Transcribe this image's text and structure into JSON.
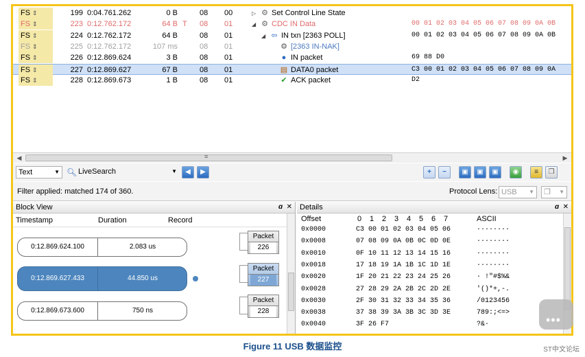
{
  "packets": [
    {
      "fs": "FS",
      "idx": "199",
      "time": "0:04.761.262",
      "len": "0 B",
      "flag": "",
      "dev": "08",
      "ep": "00",
      "indent": 0,
      "tri": "▷",
      "icon": "gear",
      "rec": "Set Control Line State",
      "data": "",
      "style": "normal"
    },
    {
      "fs": "FS",
      "idx": "223",
      "time": "0:12.762.172",
      "len": "64 B",
      "flag": "T",
      "dev": "08",
      "ep": "01",
      "indent": 0,
      "tri": "◢",
      "icon": "gear",
      "rec": "CDC IN Data",
      "data": "00 01 02 03 04 05 06 07 08 09 0A 0B",
      "style": "red"
    },
    {
      "fs": "FS",
      "idx": "224",
      "time": "0:12.762.172",
      "len": "64 B",
      "flag": "",
      "dev": "08",
      "ep": "01",
      "indent": 1,
      "tri": "◢",
      "icon": "in-txn",
      "rec": "IN txn   [2363 POLL]",
      "data": "00 01 02 03 04 05 06 07 08 09 0A 0B",
      "style": "normal"
    },
    {
      "fs": "FS",
      "idx": "225",
      "time": "0:12.762.172",
      "len": "107 ms",
      "flag": "",
      "dev": "08",
      "ep": "01",
      "indent": 2,
      "tri": "",
      "icon": "nak",
      "rec": "[2363 IN-NAK]",
      "data": "",
      "style": "grey"
    },
    {
      "fs": "FS",
      "idx": "226",
      "time": "0:12.869.624",
      "len": "3 B",
      "flag": "",
      "dev": "08",
      "ep": "01",
      "indent": 2,
      "tri": "",
      "icon": "in-packet",
      "rec": "IN packet",
      "data": "69 88 D0",
      "style": "normal"
    },
    {
      "fs": "FS",
      "idx": "227",
      "time": "0:12.869.627",
      "len": "67 B",
      "flag": "",
      "dev": "08",
      "ep": "01",
      "indent": 2,
      "tri": "",
      "icon": "data0",
      "rec": "DATA0 packet",
      "data": "C3 00 01 02 03 04 05 06 07 08 09 0A",
      "style": "sel"
    },
    {
      "fs": "FS",
      "idx": "228",
      "time": "0:12.869.673",
      "len": "1 B",
      "flag": "",
      "dev": "08",
      "ep": "01",
      "indent": 2,
      "tri": "",
      "icon": "ack",
      "rec": "ACK packet",
      "data": "D2",
      "style": "normal"
    }
  ],
  "toolbar": {
    "view_mode": "Text",
    "search_mode": "LiveSearch"
  },
  "filter": {
    "status": "Filter applied: matched 174 of 360.",
    "lens_label": "Protocol Lens:",
    "lens_value": "USB"
  },
  "block_view": {
    "title": "Block View",
    "columns": [
      "Timestamp",
      "Duration",
      "Record"
    ],
    "blocks": [
      {
        "timestamp": "0:12.869.624.100",
        "duration": "2.083 us",
        "packet_label": "Packet",
        "packet_num": "226",
        "selected": false
      },
      {
        "timestamp": "0:12.869.627.433",
        "duration": "44.850 us",
        "packet_label": "Packet",
        "packet_num": "227",
        "selected": true
      },
      {
        "timestamp": "0:12.869.673.600",
        "duration": "750 ns",
        "packet_label": "Packet",
        "packet_num": "228",
        "selected": false
      }
    ]
  },
  "details": {
    "title": "Details",
    "header": [
      "Offset",
      "0",
      "1",
      "2",
      "3",
      "4",
      "5",
      "6",
      "7",
      "ASCII"
    ],
    "rows": [
      {
        "offset": "0x0000",
        "bytes": "C3 00 01 02 03 04 05 06",
        "ascii": "········"
      },
      {
        "offset": "0x0008",
        "bytes": "07 08 09 0A 0B 0C 0D 0E",
        "ascii": "········"
      },
      {
        "offset": "0x0010",
        "bytes": "0F 10 11 12 13 14 15 16",
        "ascii": "········"
      },
      {
        "offset": "0x0018",
        "bytes": "17 18 19 1A 1B 1C 1D 1E",
        "ascii": "········"
      },
      {
        "offset": "0x0020",
        "bytes": "1F 20 21 22 23 24 25 26",
        "ascii": "· !\"#$%&"
      },
      {
        "offset": "0x0028",
        "bytes": "27 28 29 2A 2B 2C 2D 2E",
        "ascii": "'()*+,-."
      },
      {
        "offset": "0x0030",
        "bytes": "2F 30 31 32 33 34 35 36",
        "ascii": "/0123456"
      },
      {
        "offset": "0x0038",
        "bytes": "37 38 39 3A 3B 3C 3D 3E",
        "ascii": "789:;<=>"
      },
      {
        "offset": "0x0040",
        "bytes": "3F 26 F7",
        "ascii": "?&·"
      }
    ]
  },
  "caption": "Figure 11 USB 数据监控",
  "watermark": "ST中文论坛",
  "colors": {
    "frame": "#f5c518",
    "selection": "#cfe0f7",
    "block_selected": "#4d86be",
    "red_row": "#e06a6a",
    "caption": "#1a4f8c"
  }
}
